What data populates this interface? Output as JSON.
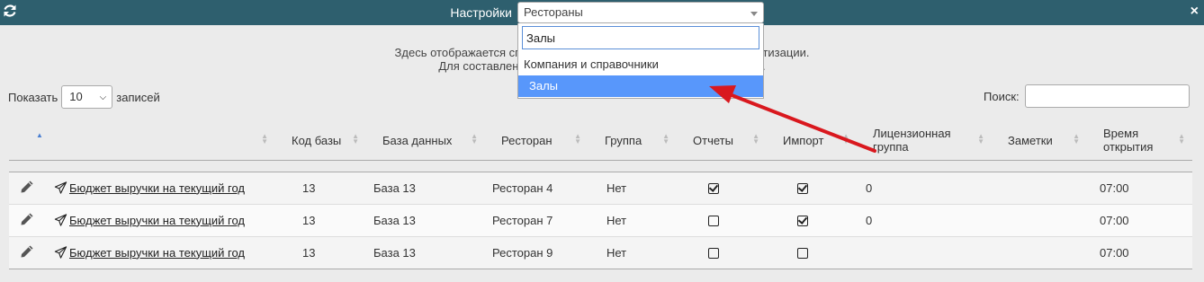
{
  "window": {
    "title": "Настройки",
    "close_glyph": "×"
  },
  "select": {
    "current": "Рестораны",
    "search_value": "Залы",
    "options": [
      "Компания и справочники",
      "Залы"
    ]
  },
  "info": {
    "line1": "Здесь отображается список р                                                    автоматизации.",
    "line2": "Для составления бюд                                                    чок"
  },
  "length_menu": {
    "prefix": "Показать",
    "value": "10",
    "suffix": "записей"
  },
  "search": {
    "label": "Поиск:",
    "value": ""
  },
  "table": {
    "columns": [
      "",
      "",
      "Код базы",
      "База данных",
      "Ресторан",
      "Группа",
      "Отчеты",
      "Импорт",
      "Лицензионная группа",
      "Заметки",
      "Время открытия"
    ],
    "rows": [
      {
        "report": "Бюджет выручки на текущий год",
        "code": "13",
        "db": "База 13",
        "restaurant": "Ресторан 4",
        "group": "Нет",
        "reports": true,
        "import": true,
        "license": "0",
        "notes": "",
        "open": "07:00"
      },
      {
        "report": "Бюджет выручки на текущий год",
        "code": "13",
        "db": "База 13",
        "restaurant": "Ресторан 7",
        "group": "Нет",
        "reports": false,
        "import": true,
        "license": "0",
        "notes": "",
        "open": "07:00"
      },
      {
        "report": "Бюджет выручки на текущий год",
        "code": "13",
        "db": "База 13",
        "restaurant": "Ресторан 9",
        "group": "Нет",
        "reports": false,
        "import": false,
        "license": "",
        "notes": "",
        "open": "07:00"
      }
    ]
  },
  "colors": {
    "titlebar": "#2e5f6e",
    "highlight": "#5897fb",
    "annotation_arrow": "#d9181e"
  },
  "icons": [
    "refresh-icon",
    "close-icon",
    "chevron-down-icon",
    "pencil-icon",
    "paper-plane-icon",
    "sort-icon",
    "checkbox-icon"
  ]
}
